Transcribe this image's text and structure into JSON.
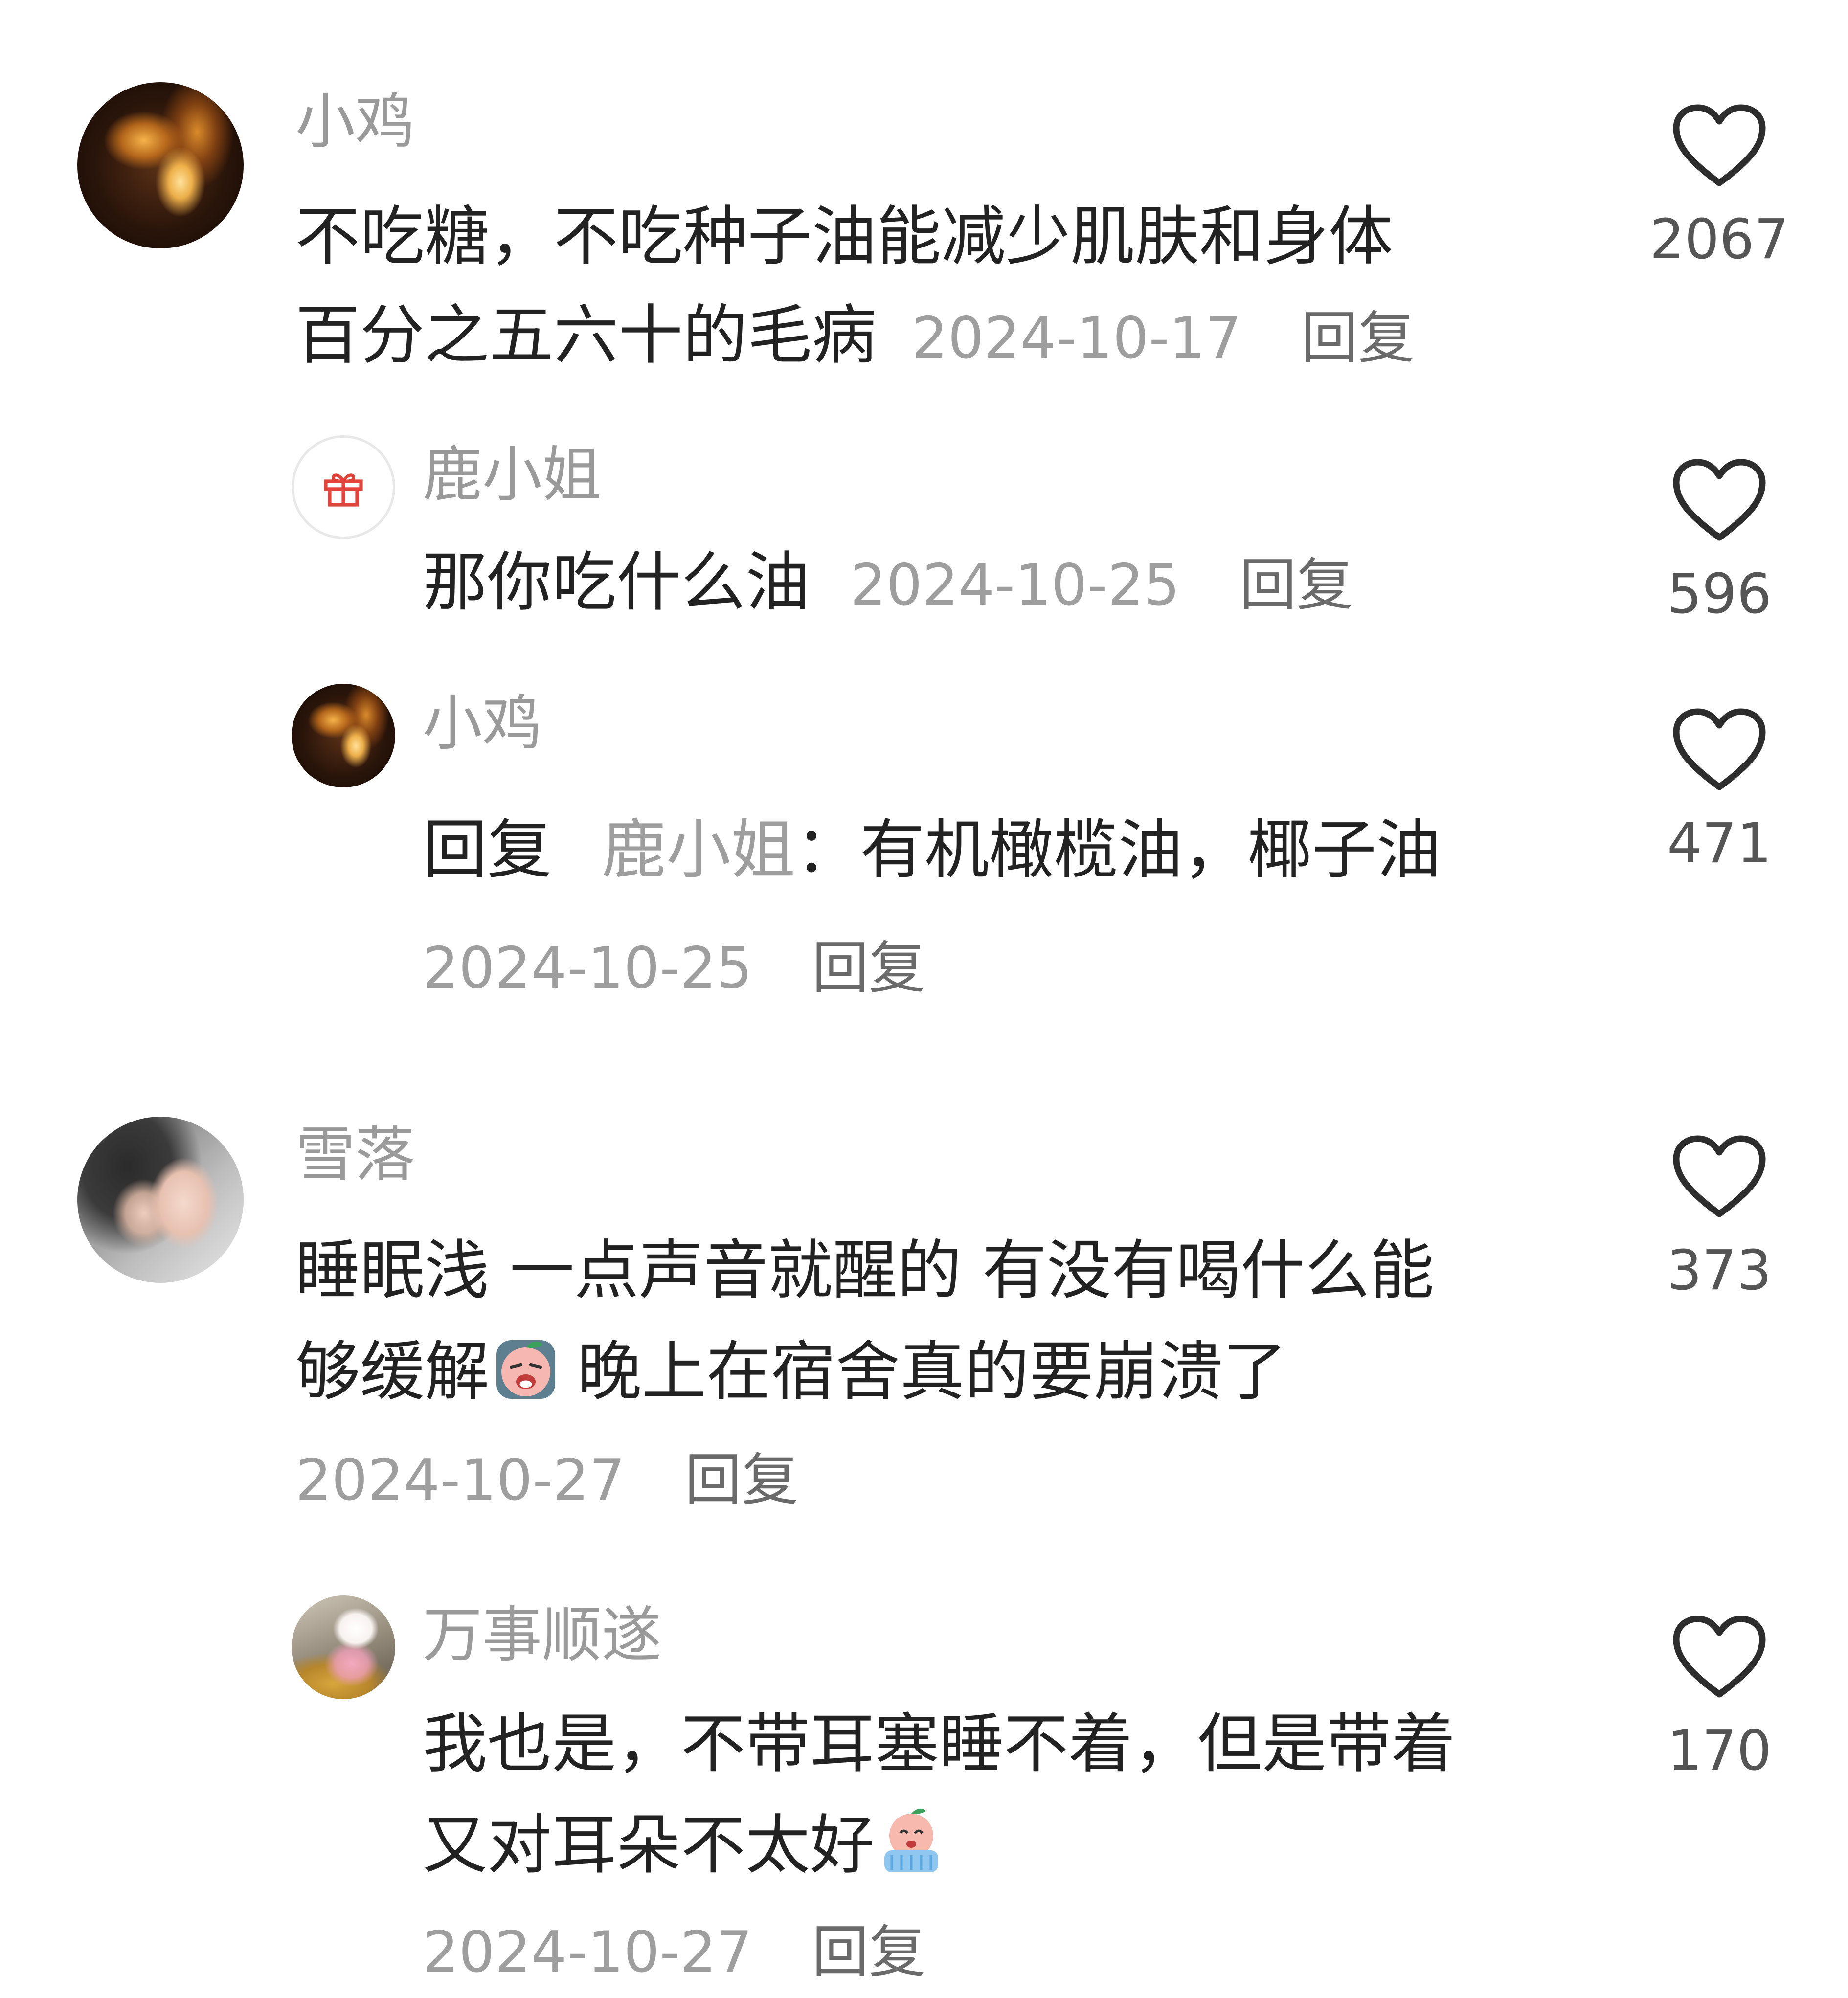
{
  "comments": [
    {
      "user": "小鸡",
      "text_line1": "不吃糖，不吃种子油能减少肌肤和身体",
      "text_line2": "百分之五六十的毛病",
      "date": "2024-10-17",
      "reply_label": "回复",
      "likes": "2067",
      "avatar": "fire-avatar"
    },
    {
      "user": "鹿小姐",
      "text": "那你吃什么油",
      "date": "2024-10-25",
      "reply_label": "回复",
      "likes": "596",
      "avatar": "gift-icon"
    },
    {
      "user": "小鸡",
      "reply_prefix": "回复",
      "reply_to": "鹿小姐",
      "reply_sep": "：",
      "text": "有机橄榄油，椰子油",
      "date": "2024-10-25",
      "reply_label": "回复",
      "likes": "471",
      "avatar": "fire-avatar"
    },
    {
      "user": "雪落",
      "text_line1": "睡眠浅 一点声音就醒的 有没有喝什么能",
      "text_line2_a": "够缓解",
      "text_line2_b": "晚上在宿舍真的要崩溃了",
      "date": "2024-10-27",
      "reply_label": "回复",
      "likes": "373",
      "avatar": "girl-avatar",
      "emoji": "crying-face-emoji"
    },
    {
      "user": "万事顺遂",
      "text_line1": "我也是，不带耳塞睡不着，但是带着",
      "text_line2": "又对耳朵不太好",
      "date": "2024-10-27",
      "reply_label": "回复",
      "likes": "170",
      "avatar": "kitty-avatar",
      "emoji": "tearful-face-emoji"
    }
  ],
  "icons": {
    "like": "heart-outline-icon",
    "gift": "gift-icon"
  },
  "colors": {
    "username": "#9a9a9a",
    "text": "#222222",
    "meta": "#9e9e9e",
    "gift_red": "#e0443a"
  }
}
